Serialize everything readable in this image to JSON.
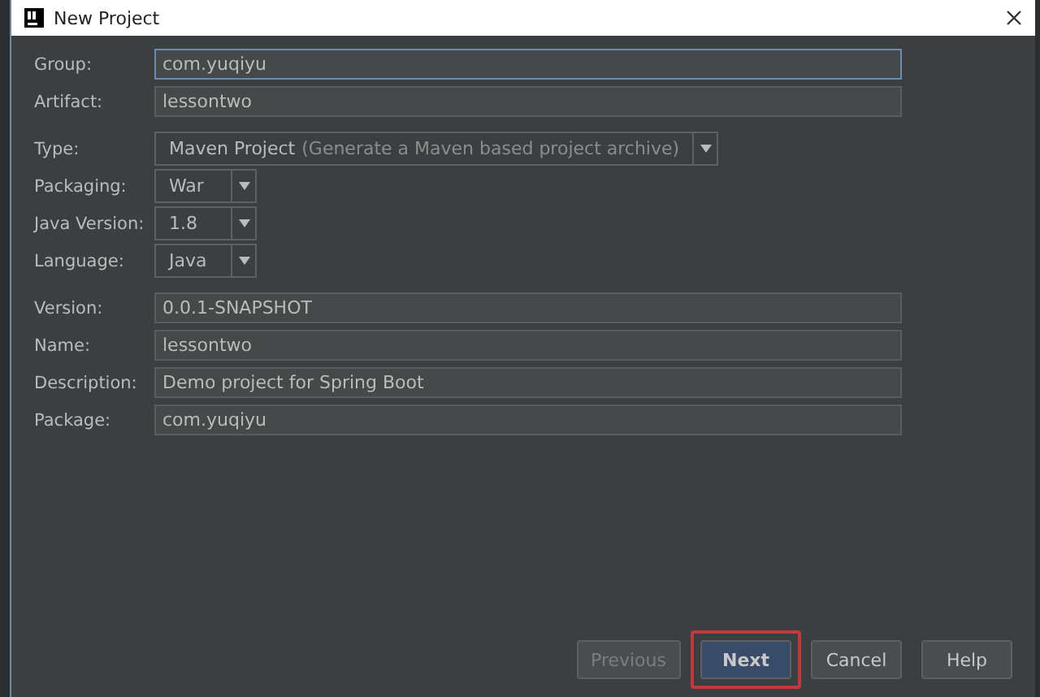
{
  "window": {
    "title": "New Project"
  },
  "fields": [
    {
      "kind": "text",
      "label": "Group:",
      "value": "com.yuqiyu",
      "focused": true
    },
    {
      "kind": "text",
      "label": "Artifact:",
      "value": "lessontwo",
      "focused": false
    },
    {
      "kind": "gap"
    },
    {
      "kind": "combo",
      "label": "Type:",
      "value": "Maven Project",
      "hint": "(Generate a Maven based project archive)"
    },
    {
      "kind": "combo",
      "label": "Packaging:",
      "value": "War"
    },
    {
      "kind": "combo",
      "label": "Java Version:",
      "value": "1.8"
    },
    {
      "kind": "combo",
      "label": "Language:",
      "value": "Java"
    },
    {
      "kind": "gap"
    },
    {
      "kind": "text",
      "label": "Version:",
      "value": "0.0.1-SNAPSHOT",
      "focused": false
    },
    {
      "kind": "text",
      "label": "Name:",
      "value": "lessontwo",
      "focused": false
    },
    {
      "kind": "text",
      "label": "Description:",
      "value": "Demo project for Spring Boot",
      "focused": false
    },
    {
      "kind": "text",
      "label": "Package:",
      "value": "com.yuqiyu",
      "focused": false
    }
  ],
  "buttons": [
    {
      "label": "Previous",
      "default": false,
      "disabled": true,
      "highlighted": false
    },
    {
      "label": "Next",
      "default": true,
      "disabled": false,
      "highlighted": true
    },
    {
      "label": "Cancel",
      "default": false,
      "disabled": false,
      "highlighted": false
    },
    {
      "label": "Help",
      "default": false,
      "disabled": false,
      "highlighted": false
    }
  ]
}
